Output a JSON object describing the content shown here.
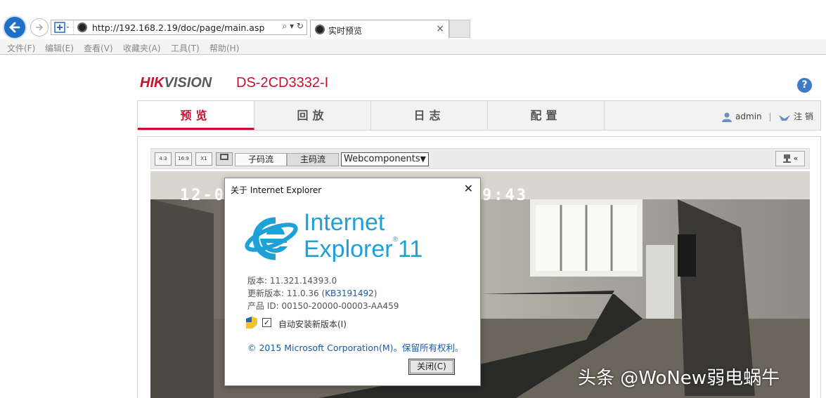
{
  "browser": {
    "url": "http://192.168.2.19/doc/page/main.asp",
    "address_controls": "⌕ ▾ ↻",
    "tab_title": "实时预览",
    "tab_close": "×",
    "menu": [
      "文件(F)",
      "编辑(E)",
      "查看(V)",
      "收藏夹(A)",
      "工具(T)",
      "帮助(H)"
    ]
  },
  "app": {
    "logo_red": "HIK",
    "logo_grey": "VISION",
    "model": "DS-2CD3332-I",
    "help": "?",
    "nav": [
      "预览",
      "回放",
      "日志",
      "配置"
    ],
    "user": "admin",
    "separator": "|",
    "logout": "注 销"
  },
  "toolbar": {
    "ratio_buttons": [
      "4:3",
      "16:9",
      "X1"
    ],
    "substream": "子码流",
    "mainstream": "主码流",
    "plugin": "Webcomponents",
    "ptz_arrow": "«"
  },
  "video": {
    "osd_left": "12-0",
    "osd_right": "9:43"
  },
  "dialog": {
    "title": "关于 Internet Explorer",
    "product_line1": "Internet",
    "product_line2": "Explorer",
    "product_version": "11",
    "version_label": "版本: 11.321.14393.0",
    "update_prefix": "更新版本: 11.0.36 (",
    "update_kb": "KB3191492",
    "update_suffix": ")",
    "product_id": "产品 ID: 00150-20000-00003-AA459",
    "auto_update": "自动安装新版本(I)",
    "copyright_prefix": "© 2015 ",
    "copyright_link": "Microsoft Corporation(M)",
    "copyright_suffix": "。保留所有权利。",
    "close_button": "关闭(C)"
  },
  "watermark": "头条 @WoNew弱电蜗牛",
  "colors": {
    "hik_red": "#c8102e",
    "ie_blue": "#1ea0d8",
    "link_blue": "#1a5aa6"
  }
}
